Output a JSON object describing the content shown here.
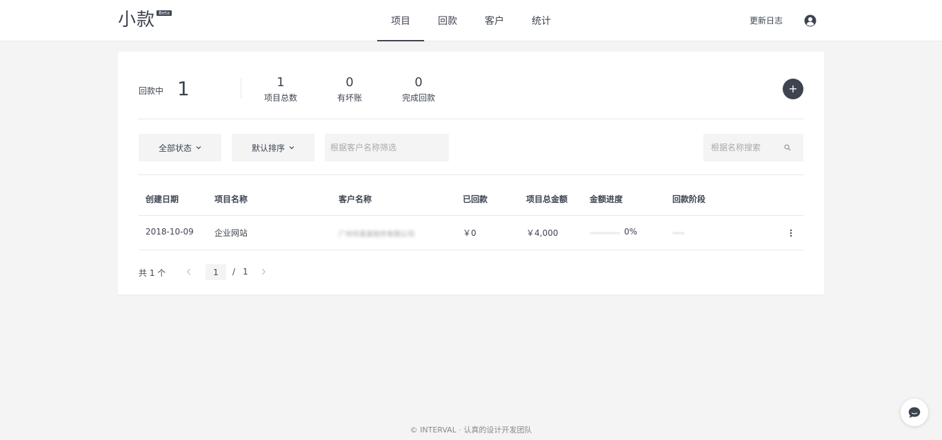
{
  "app": {
    "logo": "小款",
    "badge": "Beta"
  },
  "nav": {
    "tabs": [
      "项目",
      "回款",
      "客户",
      "统计"
    ],
    "active": "项目"
  },
  "header": {
    "changelog": "更新日志"
  },
  "stats": {
    "main_label": "回款中",
    "main_value": "1",
    "items": [
      {
        "value": "1",
        "label": "项目总数"
      },
      {
        "value": "0",
        "label": "有坏账"
      },
      {
        "value": "0",
        "label": "完成回款"
      }
    ],
    "add_label": "+"
  },
  "filters": {
    "status": "全部状态",
    "sort": "默认排序",
    "customer_placeholder": "根据客户名称筛选",
    "search_placeholder": "根据名称搜索"
  },
  "table": {
    "headers": [
      "创建日期",
      "项目名称",
      "客户名称",
      "已回款",
      "项目总金额",
      "金额进度",
      "回款阶段"
    ],
    "rows": [
      {
        "date": "2018-10-09",
        "name": "企业网站",
        "customer": "广州市某某软件有限公司",
        "received": "￥0",
        "total": "￥4,000",
        "progress": "0%",
        "progress_fraction": 0
      }
    ]
  },
  "pagination": {
    "total": "共 1 个",
    "current": "1",
    "separator": "/",
    "pages": "1"
  },
  "footer": "© INTERVAL · 认真的设计开发团队",
  "colors": {
    "primary": "#3d4450",
    "background": "#f4f4f4",
    "card": "#ffffff"
  }
}
